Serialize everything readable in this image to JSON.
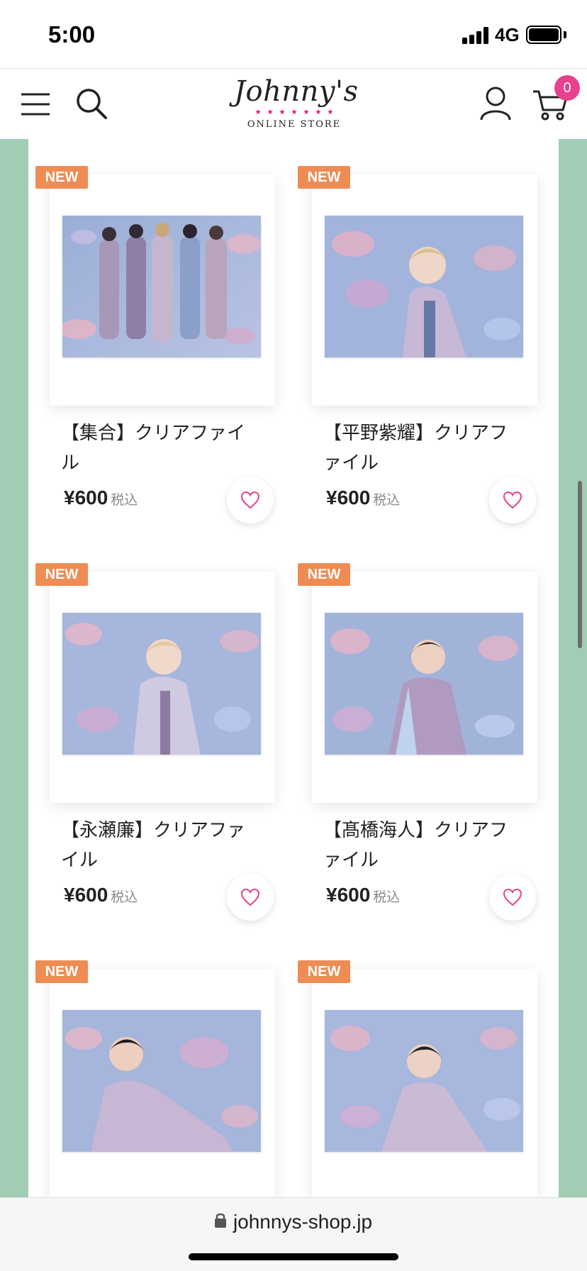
{
  "status_bar": {
    "time": "5:00",
    "network": "4G"
  },
  "header": {
    "logo": {
      "name": "Johnny's",
      "subtitle": "ONLINE STORE",
      "stars": "★★★★★★★"
    },
    "cart_count": "0"
  },
  "products": [
    {
      "badge": "NEW",
      "title": "【集合】クリアファイル",
      "price": "¥600",
      "tax_label": "税込"
    },
    {
      "badge": "NEW",
      "title": "【平野紫耀】クリアファイル",
      "price": "¥600",
      "tax_label": "税込"
    },
    {
      "badge": "NEW",
      "title": "【永瀬廉】クリアファイル",
      "price": "¥600",
      "tax_label": "税込"
    },
    {
      "badge": "NEW",
      "title": "【髙橋海人】クリアファイル",
      "price": "¥600",
      "tax_label": "税込"
    },
    {
      "badge": "NEW",
      "title": "",
      "price": "",
      "tax_label": ""
    },
    {
      "badge": "NEW",
      "title": "",
      "price": "",
      "tax_label": ""
    }
  ],
  "browser": {
    "url": "johnnys-shop.jp"
  },
  "colors": {
    "accent": "#e8418f",
    "badge": "#ee8c53",
    "side_bg": "#a2cdb5"
  }
}
